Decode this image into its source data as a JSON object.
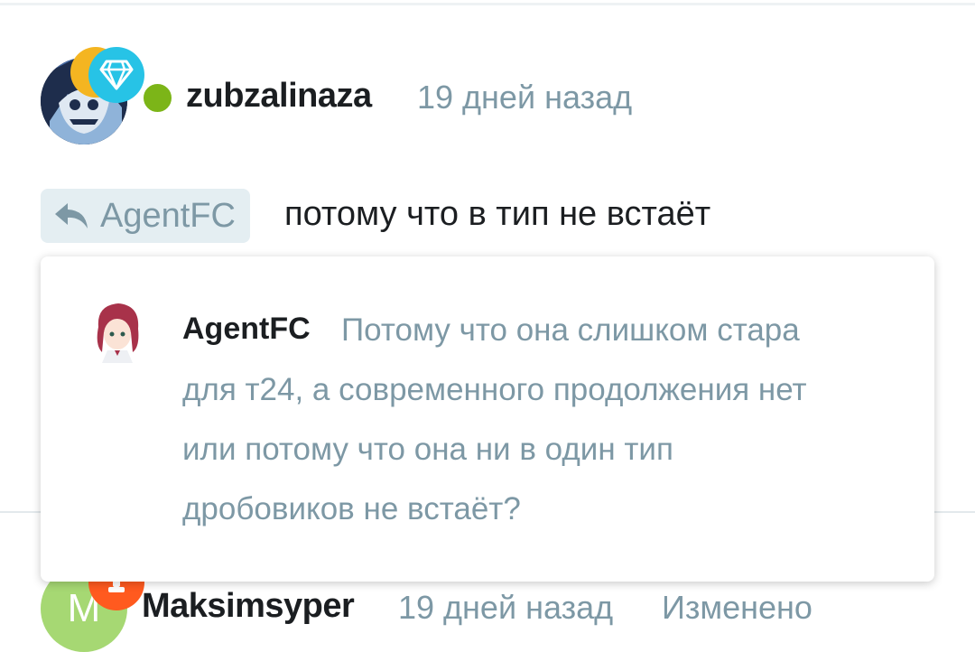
{
  "comment1": {
    "username": "zubzalinaza",
    "time": "19 дней назад",
    "online": true,
    "reply_to": "AgentFC",
    "text": "потому что в тип не встаёт"
  },
  "quote": {
    "author": "AgentFC",
    "lines": [
      "Потому что она слишком стара",
      "для т24, а современного продолжения нет",
      "или потому что она ни в один тип",
      "дробовиков не встаёт?"
    ]
  },
  "comment2": {
    "avatar_letter": "M",
    "username": "Maksimsyper",
    "time": "19 дней назад",
    "edited": "Изменено"
  },
  "colors": {
    "muted": "#7d98a5",
    "text": "#1b1e21",
    "online": "#7cb518",
    "diamond_badge": "#27c3e6",
    "orange_badge": "#f4b521",
    "red_badge": "#ff5a1f",
    "avatar2_bg": "#a6d873",
    "reply_chip_bg": "#e4eef2"
  },
  "icons": [
    "diamond-badge-icon",
    "reply-arrow-icon",
    "online-status-icon"
  ]
}
